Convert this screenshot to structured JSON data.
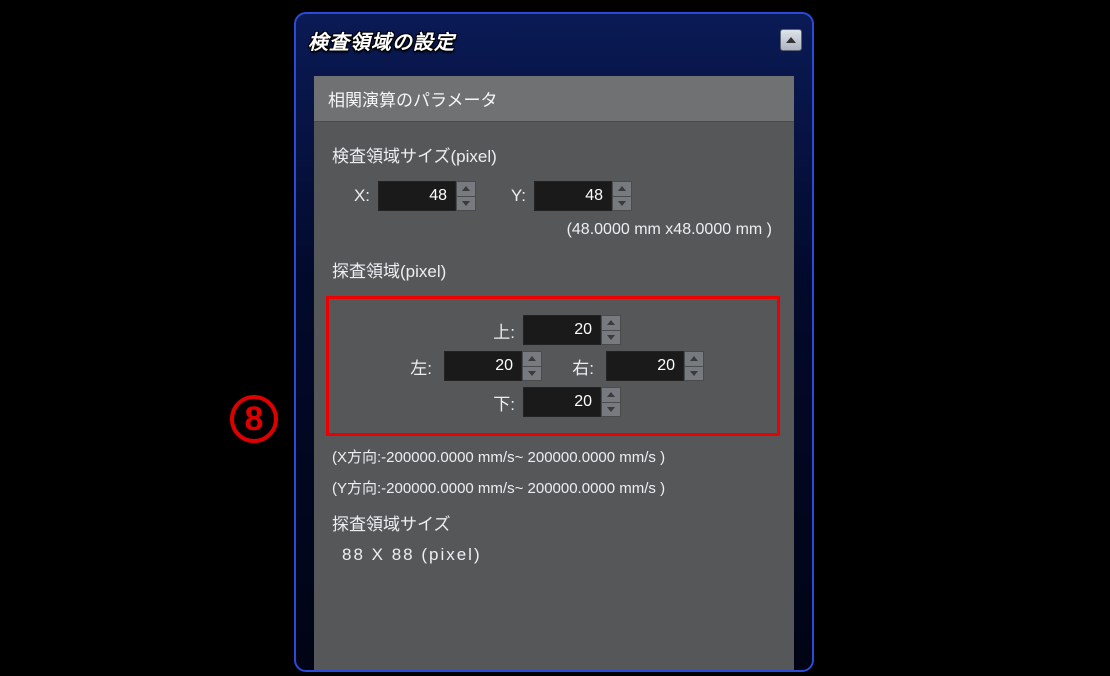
{
  "callout": {
    "label": "8"
  },
  "panel": {
    "title": "検査領域の設定",
    "section_header": "相関演算のパラメータ",
    "inspection": {
      "heading": "検査領域サイズ(pixel)",
      "x_label": "X:",
      "x_value": "48",
      "y_label": "Y:",
      "y_value": "48",
      "mm_note": "(48.0000 mm x48.0000 mm )"
    },
    "search": {
      "heading": "探査領域(pixel)",
      "top_label": "上:",
      "top_value": "20",
      "left_label": "左:",
      "left_value": "20",
      "right_label": "右:",
      "right_value": "20",
      "bottom_label": "下:",
      "bottom_value": "20"
    },
    "range": {
      "x_line": "(X方向:-200000.0000 mm/s~ 200000.0000 mm/s )",
      "y_line": "(Y方向:-200000.0000 mm/s~ 200000.0000 mm/s )"
    },
    "result": {
      "heading": "探査領域サイズ",
      "value": "88   X   88   (pixel)"
    }
  }
}
